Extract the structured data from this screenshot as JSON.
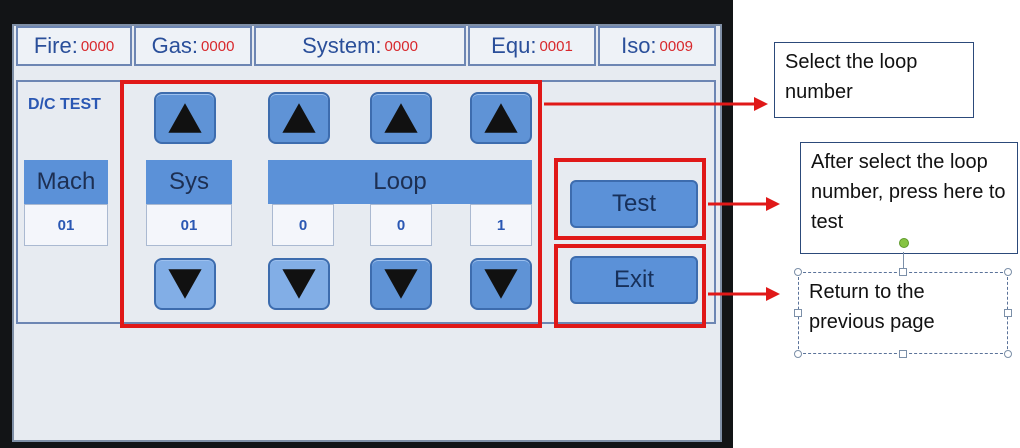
{
  "status_bar": {
    "fire": {
      "label": "Fire:",
      "value": "0000"
    },
    "gas": {
      "label": "Gas:",
      "value": "0000"
    },
    "system": {
      "label": "System:",
      "value": "0000"
    },
    "equ": {
      "label": "Equ:",
      "value": "0001"
    },
    "iso": {
      "label": "Iso:",
      "value": "0009"
    }
  },
  "panel": {
    "title": "D/C TEST",
    "mach": {
      "label": "Mach",
      "value": "01"
    },
    "sys": {
      "label": "Sys",
      "value": "01"
    },
    "loop": {
      "label": "Loop",
      "digits": [
        "0",
        "0",
        "1"
      ]
    },
    "test_label": "Test",
    "exit_label": "Exit"
  },
  "callouts": {
    "select_loop": "Select the loop number",
    "after_select": "After select the loop number, press here to test",
    "return_prev": "Return to the previous page"
  },
  "colors": {
    "highlight": "#e01818",
    "button": "#5b91d8",
    "status_value": "#d8282c",
    "status_label": "#2a4f9a"
  },
  "icons": {
    "up": "up-triangle-icon",
    "down": "down-triangle-icon"
  }
}
